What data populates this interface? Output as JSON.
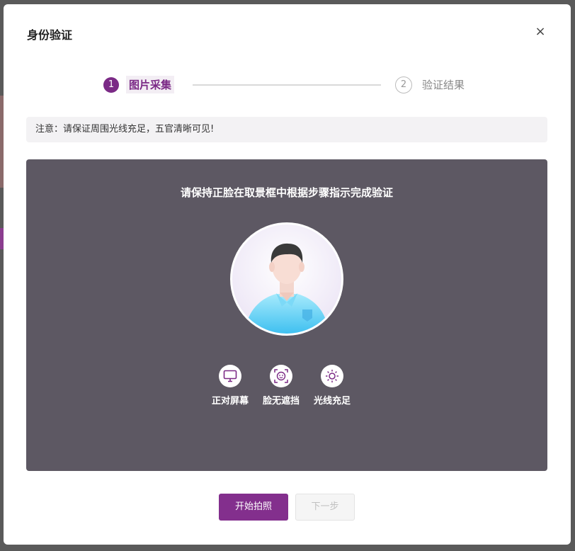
{
  "dialog": {
    "title": "身份验证",
    "close_label": "×"
  },
  "steps": [
    {
      "number": "1",
      "label": "图片采集",
      "active": true
    },
    {
      "number": "2",
      "label": "验证结果",
      "active": false
    }
  ],
  "notice": {
    "text": "注意：请保证周围光线充足，五官清晰可见!"
  },
  "capture": {
    "instruction": "请保持正脸在取景框中根据步骤指示完成验证",
    "tips": [
      {
        "icon": "monitor-icon",
        "label": "正对屏幕"
      },
      {
        "icon": "face-scan-icon",
        "label": "脸无遮挡"
      },
      {
        "icon": "sun-icon",
        "label": "光线充足"
      }
    ]
  },
  "actions": {
    "start_label": "开始拍照",
    "next_label": "下一步"
  },
  "colors": {
    "accent": "#832f8d",
    "panel": "#5d5863"
  }
}
